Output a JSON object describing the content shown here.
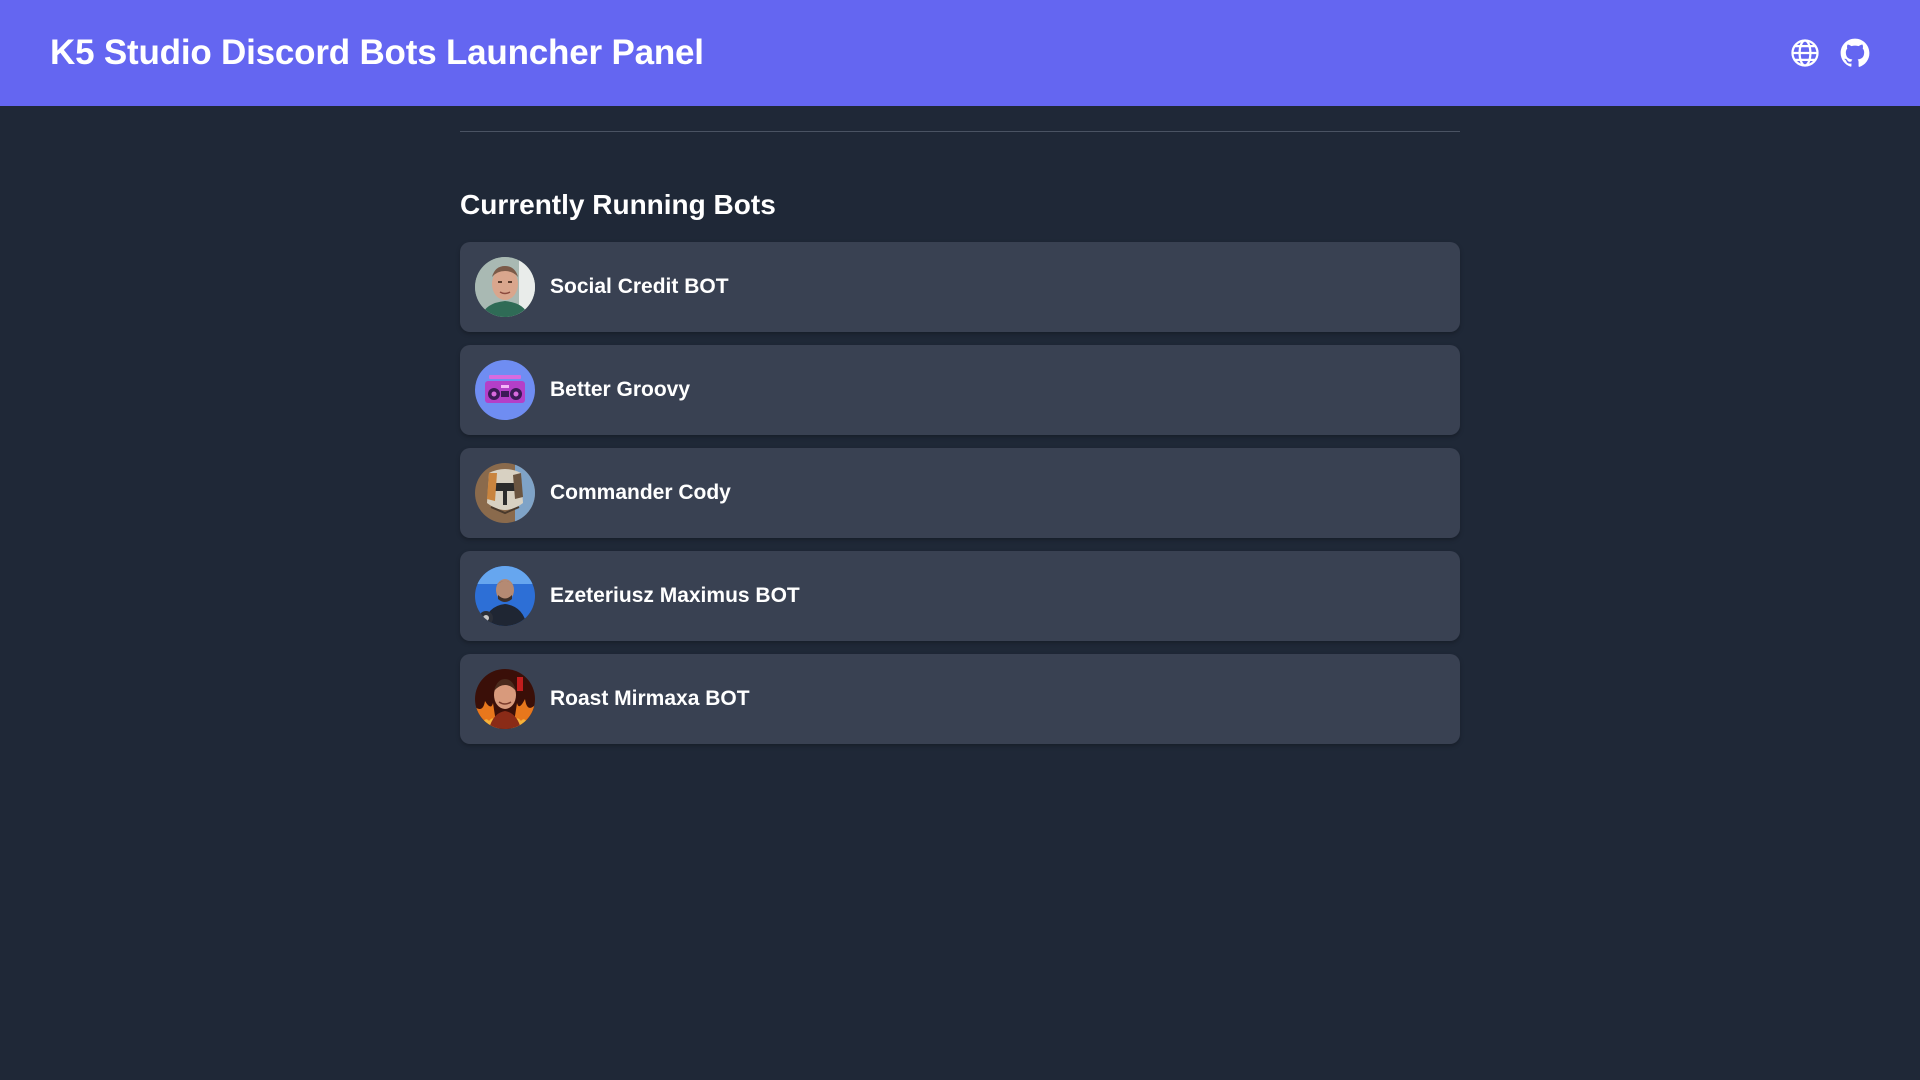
{
  "header": {
    "title": "K5 Studio Discord Bots Launcher Panel",
    "icons": [
      "globe-icon",
      "github-icon"
    ],
    "background": "#6466f1"
  },
  "main": {
    "section_title": "Currently Running Bots",
    "bots": [
      {
        "name": "Social Credit BOT",
        "avatar": "avatar-man-green-shirt"
      },
      {
        "name": "Better Groovy",
        "avatar": "avatar-boombox"
      },
      {
        "name": "Commander Cody",
        "avatar": "avatar-clone-trooper-helmet"
      },
      {
        "name": "Ezeteriusz Maximus BOT",
        "avatar": "avatar-man-blue-background"
      },
      {
        "name": "Roast Mirmaxa BOT",
        "avatar": "avatar-man-fire"
      }
    ]
  },
  "colors": {
    "page_background": "#1f2837",
    "card_background": "#394152",
    "accent": "#6466f1"
  }
}
